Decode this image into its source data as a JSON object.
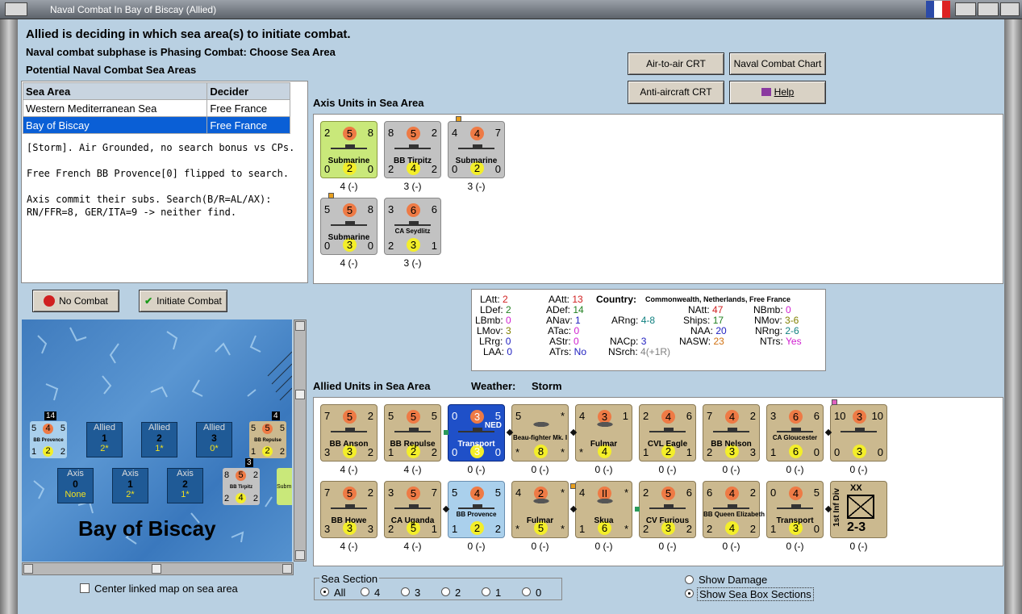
{
  "window": {
    "title": "Naval Combat In Bay of Biscay (Allied)"
  },
  "header": {
    "line1": "Allied is deciding in which sea area(s) to initiate combat.",
    "line2": "Naval combat subphase is Phasing Combat: Choose Sea Area",
    "line3": "Potential Naval Combat Sea Areas"
  },
  "sea_table": {
    "headers": [
      "Sea Area",
      "Decider"
    ],
    "rows": [
      [
        "Western Mediterranean Sea",
        "Free France"
      ],
      [
        "Bay of Biscay",
        "Free France"
      ]
    ]
  },
  "log": [
    "[Storm].  Air Grounded, no search bonus vs CPs.",
    "Free French BB Provence[0] flipped to search.",
    "Axis commit their subs.  Search(B/R=AL/AX): RN/FFR=8, GER/ITA=9 -> neither find."
  ],
  "buttons": {
    "air_to_air": "Air-to-air CRT",
    "naval_chart": "Naval Combat Chart",
    "anti_aircraft": "Anti-aircraft CRT",
    "help": "Help",
    "no_combat": "No Combat",
    "initiate": "Initiate Combat"
  },
  "axis": {
    "title": "Axis Units in Sea Area",
    "units": [
      {
        "tl": "2",
        "o": "5",
        "tr": "8",
        "name": "Submarine",
        "bl": "0",
        "y": "2",
        "br": "0",
        "cap": "4 (-)"
      },
      {
        "tl": "8",
        "o": "5",
        "tr": "2",
        "name": "BB Tirpitz",
        "bl": "2",
        "y": "4",
        "br": "2",
        "cap": "3 (-)"
      },
      {
        "tl": "4",
        "o": "4",
        "tr": "7",
        "name": "Submarine",
        "bl": "0",
        "y": "2",
        "br": "0",
        "cap": "3 (-)"
      },
      {
        "tl": "5",
        "o": "5",
        "tr": "8",
        "name": "Submarine",
        "bl": "0",
        "y": "3",
        "br": "0",
        "cap": "4 (-)"
      },
      {
        "tl": "3",
        "o": "6",
        "tr": "6",
        "name": "CA Seydlitz",
        "bl": "2",
        "y": "3",
        "br": "1",
        "cap": "3 (-)"
      }
    ]
  },
  "stats": {
    "LAtt": "2",
    "LDef": "2",
    "LBmb": "0",
    "LMov": "3",
    "LRrg": "0",
    "LAA": "0",
    "AAtt": "13",
    "ADef": "14",
    "ANav": "1",
    "ATac": "0",
    "AStr": "0",
    "ATrs": "No",
    "country_label": "Country:",
    "country": "Commonwealth, Netherlands, Free France",
    "ARng": "4-8",
    "NACp": "3",
    "NSrch": "4(+1R)",
    "NAtt": "47",
    "Ships": "17",
    "NAA": "20",
    "NASW": "23",
    "NBmb": "0",
    "NMov": "3-6",
    "NRng": "2-6",
    "NTrs": "Yes"
  },
  "allied": {
    "title": "Allied Units in Sea Area",
    "weather_label": "Weather:",
    "weather": "Storm",
    "units": [
      {
        "tl": "7",
        "o": "5",
        "tr": "2",
        "name": "BB Anson",
        "bl": "3",
        "y": "3",
        "br": "2",
        "cap": "4 (-)"
      },
      {
        "tl": "5",
        "o": "5",
        "tr": "5",
        "name": "BB Repulse",
        "bl": "1",
        "y": "2",
        "br": "2",
        "cap": "4 (-)"
      },
      {
        "tl": "0",
        "o": "3",
        "tr": "5",
        "name": "Transport",
        "bl": "0",
        "y": "3",
        "br": "0",
        "cap": "0 (-)",
        "tag": "NED"
      },
      {
        "tl": "5",
        "o": "",
        "tr": "*",
        "name": "Beau-fighter Mk. I",
        "bl": "*",
        "y": "8",
        "br": "*",
        "cap": "0 (-)"
      },
      {
        "tl": "4",
        "o": "3",
        "tr": "1",
        "name": "Fulmar",
        "bl": "*",
        "y": "4",
        "br": "",
        "cap": "0 (-)"
      },
      {
        "tl": "2",
        "o": "4",
        "tr": "6",
        "name": "CVL Eagle",
        "bl": "1",
        "y": "2",
        "br": "1",
        "cap": "0 (-)"
      },
      {
        "tl": "7",
        "o": "4",
        "tr": "2",
        "name": "BB Nelson",
        "bl": "2",
        "y": "3",
        "br": "3",
        "cap": "0 (-)"
      },
      {
        "tl": "3",
        "o": "6",
        "tr": "6",
        "name": "CA Gloucester",
        "bl": "1",
        "y": "6",
        "br": "0",
        "cap": "0 (-)"
      },
      {
        "tl": "10",
        "o": "3",
        "tr": "10",
        "name": "",
        "bl": "0",
        "y": "3",
        "br": "0",
        "cap": "0 (-)"
      },
      {
        "tl": "7",
        "o": "5",
        "tr": "2",
        "name": "BB Howe",
        "bl": "3",
        "y": "3",
        "br": "3",
        "cap": "4 (-)"
      },
      {
        "tl": "3",
        "o": "5",
        "tr": "7",
        "name": "CA Uganda",
        "bl": "2",
        "y": "5",
        "br": "1",
        "cap": "4 (-)"
      },
      {
        "tl": "5",
        "o": "4",
        "tr": "5",
        "name": "BB Provence",
        "bl": "1",
        "y": "2",
        "br": "2",
        "cap": "0 (-)"
      },
      {
        "tl": "4",
        "o": "2",
        "tr": "*",
        "name": "Fulmar",
        "bl": "*",
        "y": "5",
        "br": "*",
        "cap": "0 (-)"
      },
      {
        "tl": "4",
        "o": "II",
        "tr": "*",
        "name": "Skua",
        "bl": "1",
        "y": "6",
        "br": "*",
        "cap": "0 (-)"
      },
      {
        "tl": "2",
        "o": "5",
        "tr": "6",
        "name": "CV Furious",
        "bl": "2",
        "y": "3",
        "br": "2",
        "cap": "0 (-)"
      },
      {
        "tl": "6",
        "o": "4",
        "tr": "2",
        "name": "BB Queen Elizabeth",
        "bl": "2",
        "y": "4",
        "br": "2",
        "cap": "0 (-)"
      },
      {
        "tl": "0",
        "o": "4",
        "tr": "5",
        "name": "Transport",
        "bl": "1",
        "y": "3",
        "br": "0",
        "cap": "0 (-)"
      },
      {
        "tl": "",
        "o": "",
        "tr": "",
        "name": "1st Inf Div",
        "bl": "XX",
        "y": "",
        "br": "2-3",
        "cap": "0 (-)"
      }
    ]
  },
  "map": {
    "name": "Bay of Biscay",
    "allied_boxes": [
      {
        "t": "Allied",
        "v": "1",
        "s": "2*"
      },
      {
        "t": "Allied",
        "v": "2",
        "s": "1*"
      },
      {
        "t": "Allied",
        "v": "3",
        "s": "0*"
      }
    ],
    "axis_boxes": [
      {
        "t": "Axis",
        "v": "0",
        "s": "None"
      },
      {
        "t": "Axis",
        "v": "1",
        "s": "2*"
      },
      {
        "t": "Axis",
        "v": "2",
        "s": "1*"
      }
    ],
    "counter_left": {
      "stack": "14",
      "tl": "5",
      "o": "4",
      "tr": "5",
      "name": "BB Provence",
      "bl": "1",
      "y": "2",
      "br": "2"
    },
    "counter_right": {
      "stack": "4",
      "tl": "5",
      "o": "5",
      "tr": "5",
      "name": "BB Repulse",
      "bl": "1",
      "y": "2",
      "br": "2"
    },
    "counter_axis": {
      "stack": "3",
      "tl": "8",
      "o": "5",
      "tr": "2",
      "name": "BB Tirpitz",
      "bl": "2",
      "y": "4",
      "br": "2"
    },
    "counter_axis_partial": "Subm"
  },
  "center_checkbox": "Center linked map on sea area",
  "sea_section": {
    "label": "Sea Section",
    "options": [
      "All",
      "4",
      "3",
      "2",
      "1",
      "0"
    ],
    "selected": "All"
  },
  "display_options": [
    "Show Damage",
    "Show Sea Box Sections"
  ],
  "display_selected": "Show Sea Box Sections"
}
